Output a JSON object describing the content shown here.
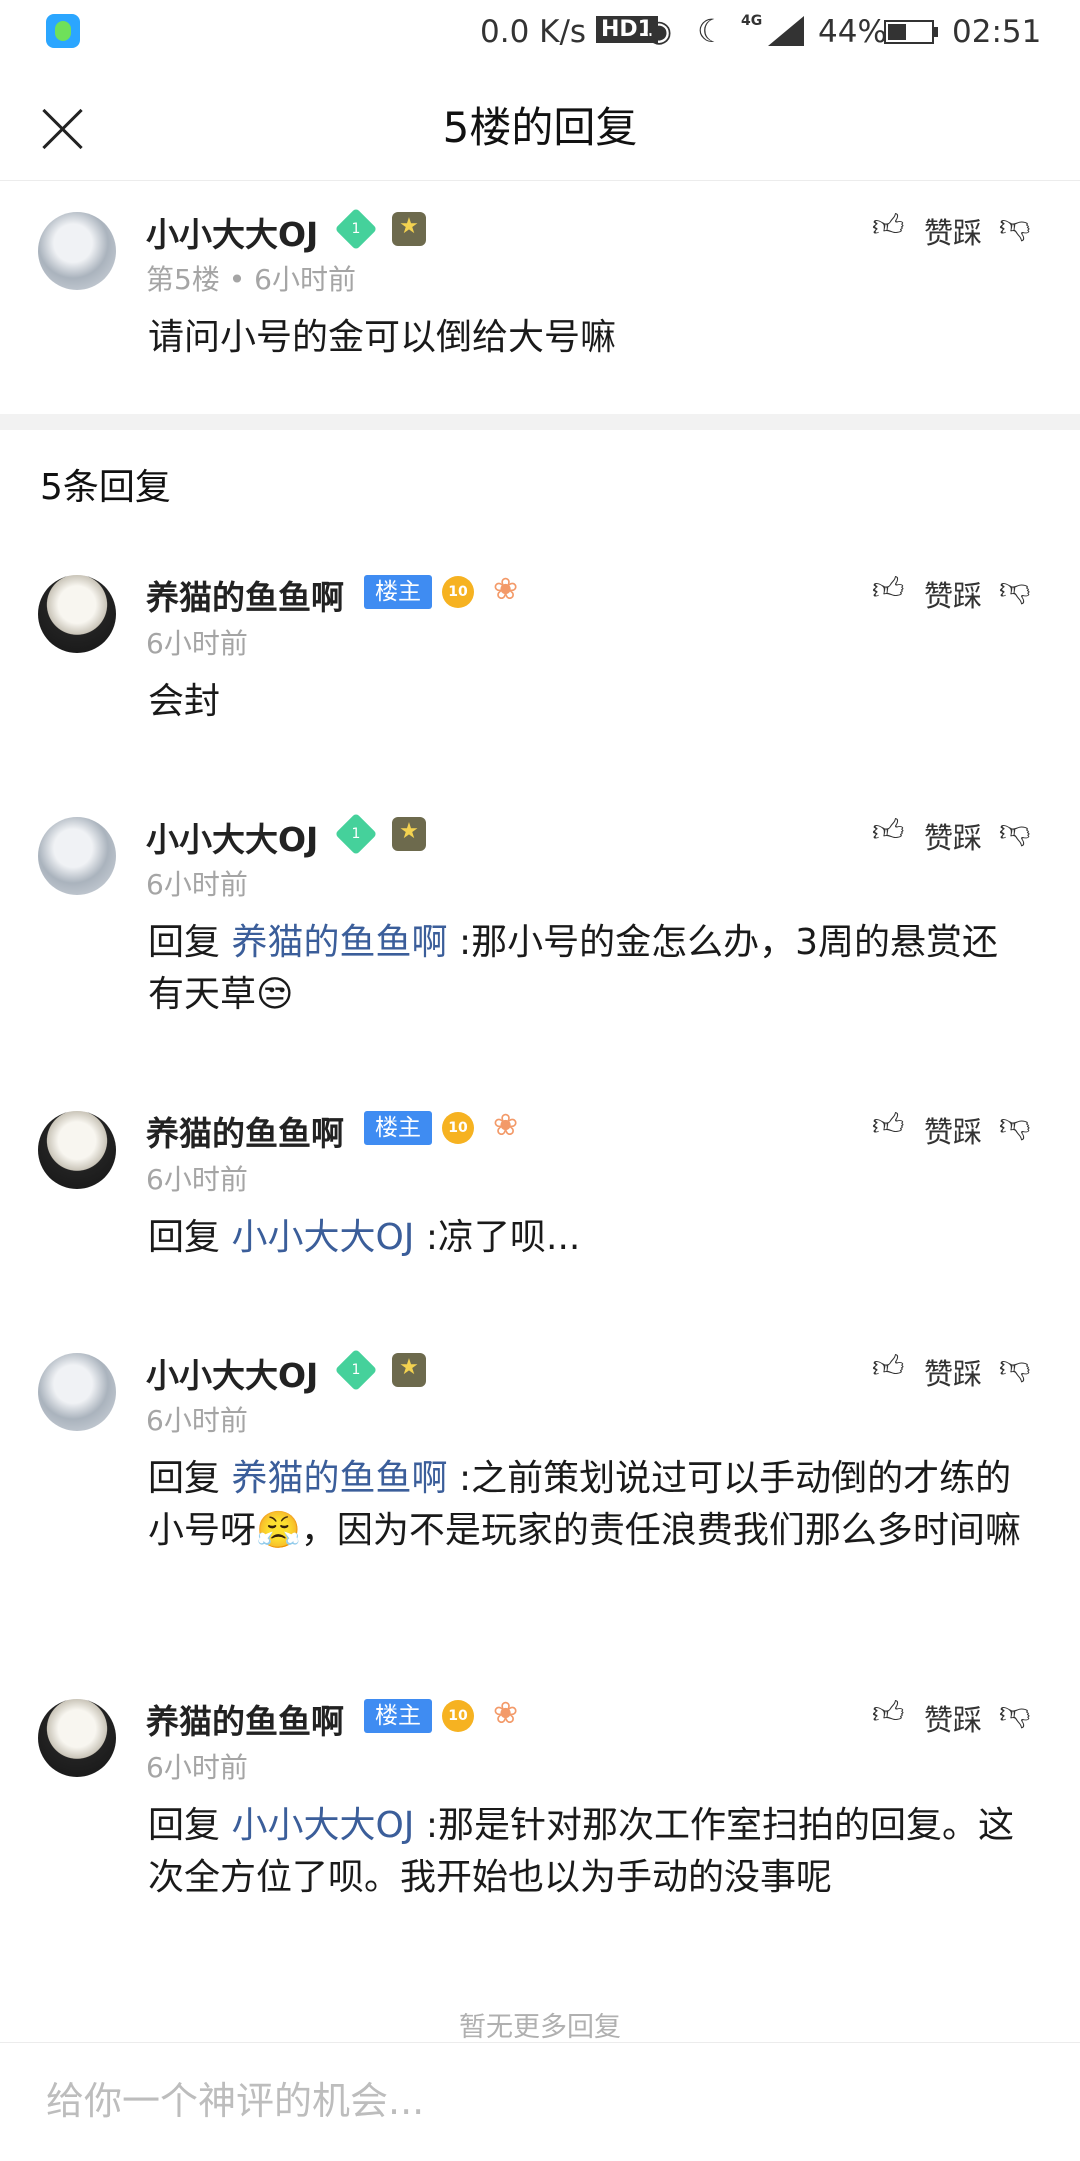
{
  "status_bar": {
    "speed": "0.0 K/s",
    "hd": "HD1",
    "network": "4G",
    "battery_pct": "44%",
    "battery_level": 0.44,
    "time": "02:51"
  },
  "header": {
    "title": "5楼的回复",
    "close_icon": "close-icon"
  },
  "vote": {
    "like_label": "赞",
    "dislike_label": "踩"
  },
  "floor": {
    "username": "小小大大OJ",
    "level": "1",
    "meta": "第5楼 • 6小时前",
    "content": "请问小号的金可以倒给大号嘛"
  },
  "reply_count": "5条回复",
  "replies": [
    {
      "username": "养猫的鱼鱼啊",
      "badge": "楼主",
      "level": "10",
      "time": "6小时前",
      "content": "会封"
    },
    {
      "username": "小小大大OJ",
      "level": "1",
      "time": "6小时前",
      "reply_prefix": "回复",
      "reply_to": "养猫的鱼鱼啊",
      "content": ":那小号的金怎么办，3周的悬赏还有天草😒"
    },
    {
      "username": "养猫的鱼鱼啊",
      "badge": "楼主",
      "level": "10",
      "time": "6小时前",
      "reply_prefix": "回复",
      "reply_to": "小小大大OJ",
      "content": ":凉了呗..."
    },
    {
      "username": "小小大大OJ",
      "level": "1",
      "time": "6小时前",
      "reply_prefix": "回复",
      "reply_to": "养猫的鱼鱼啊",
      "content": ":之前策划说过可以手动倒的才练的小号呀😤，因为不是玩家的责任浪费我们那么多时间嘛"
    },
    {
      "username": "养猫的鱼鱼啊",
      "badge": "楼主",
      "level": "10",
      "time": "6小时前",
      "reply_prefix": "回复",
      "reply_to": "小小大大OJ",
      "content": ":那是针对那次工作室扫拍的回复。这次全方位了呗。我开始也以为手动的没事呢"
    }
  ],
  "footer_note": "暂无更多回复",
  "input": {
    "placeholder": "给你一个神评的机会..."
  }
}
